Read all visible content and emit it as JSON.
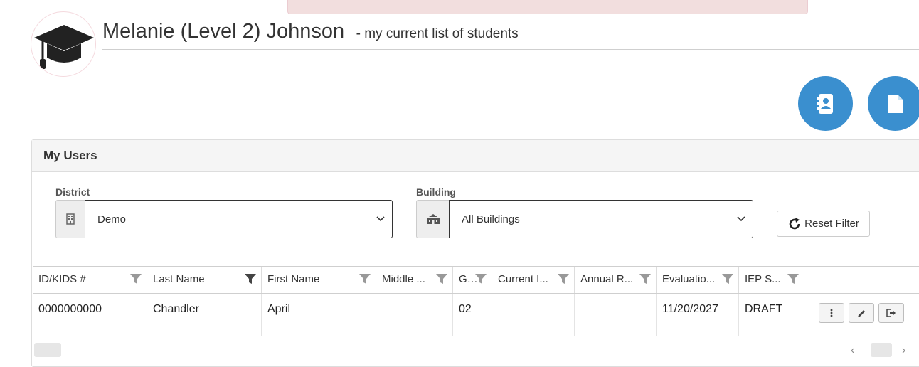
{
  "header": {
    "name": "Melanie (Level 2) Johnson",
    "subtitle": "- my current list of students",
    "icons": {
      "avatar": "graduation-cap-icon",
      "contacts": "address-book-icon",
      "document": "file-icon"
    }
  },
  "panel": {
    "title": "My Users",
    "filters": {
      "district_label": "District",
      "district_value": "Demo",
      "building_label": "Building",
      "building_value": "All Buildings",
      "reset_label": "Reset Filter"
    }
  },
  "grid": {
    "columns": [
      "ID/KIDS #",
      "Last Name",
      "First Name",
      "Middle ...",
      "G..",
      "Current I...",
      "Annual R...",
      "Evaluatio...",
      "IEP S..."
    ],
    "rows": [
      [
        "0000000000",
        "Chandler",
        "April",
        "",
        "02",
        "",
        "",
        "11/20/2027",
        "DRAFT"
      ]
    ]
  },
  "colors": {
    "accent": "#3a8fcf",
    "alert_bg": "#f2dede",
    "panel_heading_bg": "#f5f5f5"
  }
}
